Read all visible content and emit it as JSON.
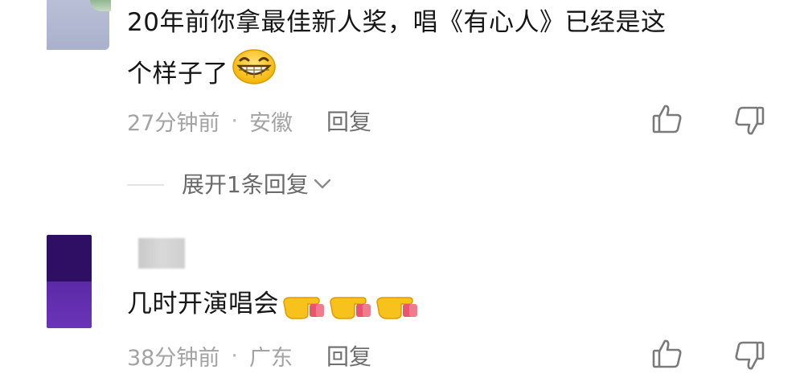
{
  "comments": [
    {
      "text_line1": "20年前你拿最佳新人奖，唱《有心人》已经是这",
      "text_line2": "个样子了",
      "text_emoji": "grinning-face-emoji",
      "time": "27分钟前",
      "separator": "·",
      "location": "安徽",
      "reply_label": "回复",
      "expand_label": "展开1条回复"
    },
    {
      "text": "几时开演唱会",
      "text_emojis": [
        "pointing-hand-emoji",
        "pointing-hand-emoji",
        "pointing-hand-emoji"
      ],
      "time": "38分钟前",
      "separator": "·",
      "location": "广东",
      "reply_label": "回复"
    }
  ],
  "icons": {
    "like": "thumbs-up-icon",
    "dislike": "thumbs-down-icon",
    "expand": "chevron-down-icon"
  },
  "colors": {
    "text_primary": "#161616",
    "text_meta": "#a3a3a3",
    "text_action": "#6f6f6f",
    "avatar2_top": "#2e0f63",
    "avatar2_bottom": "#6a34b8"
  }
}
